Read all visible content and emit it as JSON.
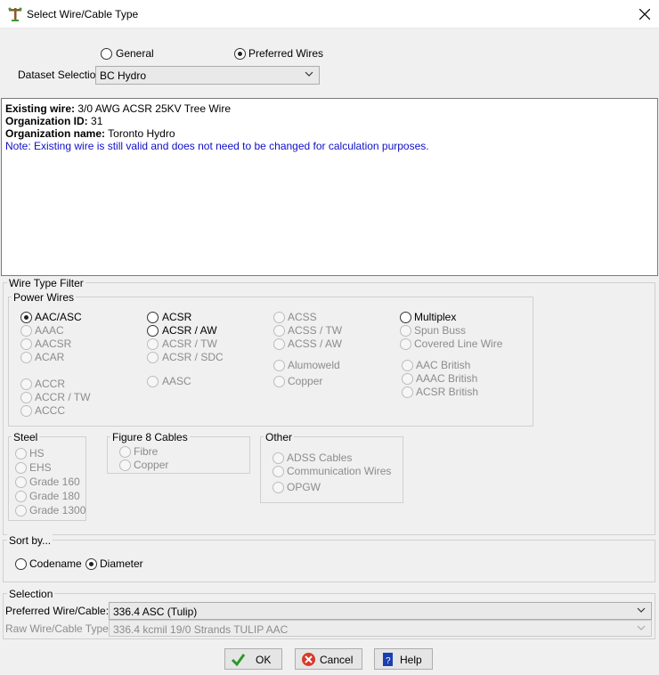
{
  "window": {
    "title": "Select Wire/Cable Type",
    "close_icon": "close-icon"
  },
  "mode": {
    "general_label": "General",
    "preferred_label": "Preferred Wires",
    "selected": "preferred"
  },
  "dataset": {
    "label": "Dataset Selection",
    "value": "BC Hydro"
  },
  "info": {
    "existing_wire_label": "Existing wire:",
    "existing_wire_value": "3/0 AWG ACSR 25KV Tree Wire",
    "org_id_label": "Organization ID:",
    "org_id_value": "31",
    "org_name_label": "Organization name:",
    "org_name_value": "Toronto Hydro",
    "note": "Note: Existing wire is still valid and does not need to be changed for calculation purposes."
  },
  "filter": {
    "title": "Wire Type Filter",
    "power_wires": {
      "title": "Power Wires",
      "col1": [
        "AAC/ASC",
        "AAAC",
        "AACSR",
        "ACAR",
        "ACCR",
        "ACCR / TW",
        "ACCC"
      ],
      "col2": [
        "ACSR",
        "ACSR / AW",
        "ACSR / TW",
        "ACSR / SDC",
        "AASC"
      ],
      "col3": [
        "ACSS",
        "ACSS / TW",
        "ACSS / AW",
        "Alumoweld",
        "Copper"
      ],
      "col4": [
        "Multiplex",
        "Spun Buss",
        "Covered Line Wire",
        "AAC British",
        "AAAC British",
        "ACSR British"
      ]
    },
    "steel": {
      "title": "Steel",
      "items": [
        "HS",
        "EHS",
        "Grade 160",
        "Grade 180",
        "Grade 1300"
      ]
    },
    "fig8": {
      "title": "Figure 8 Cables",
      "items": [
        "Fibre",
        "Copper"
      ]
    },
    "other": {
      "title": "Other",
      "items": [
        "ADSS Cables",
        "Communication Wires",
        "OPGW"
      ]
    }
  },
  "sort": {
    "title": "Sort by...",
    "codename_label": "Codename",
    "diameter_label": "Diameter",
    "selected": "diameter"
  },
  "selection": {
    "title": "Selection",
    "preferred_label": "Preferred Wire/Cable:",
    "preferred_value": "336.4 ASC (Tulip)",
    "raw_label": "Raw Wire/Cable Type:",
    "raw_value": "336.4 kcmil 19/0 Strands TULIP AAC"
  },
  "buttons": {
    "ok_label": "OK",
    "cancel_label": "Cancel",
    "help_label": "Help"
  },
  "colors": {
    "note": "#1010c8",
    "ok_check": "#2a9a2a",
    "cancel_red": "#d83a2a",
    "help_blue": "#1a3fb0"
  }
}
